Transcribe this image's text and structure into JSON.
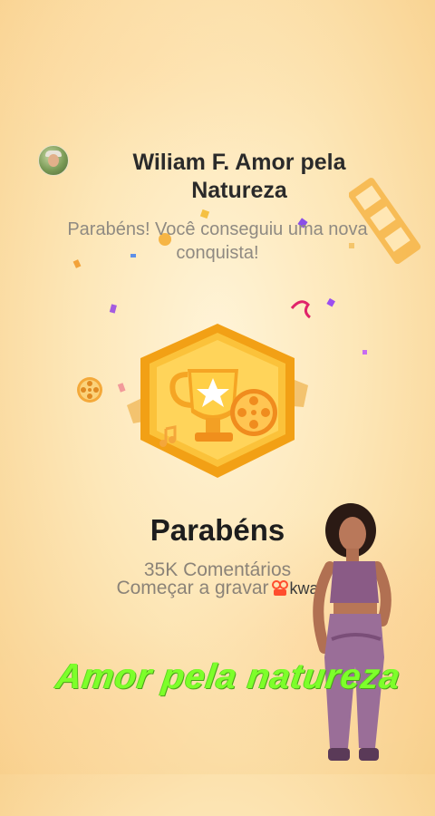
{
  "profile": {
    "name": "Wiliam F. Amor pela Natureza",
    "avatar_icon": "profile-avatar"
  },
  "message": {
    "subtitle": "Parabéns! Você conseguiu uma nova conquista!"
  },
  "achievement": {
    "badge_icon": "trophy-film-badge",
    "title": "Parabéns",
    "comments": "35K Comentários",
    "cta_text": "Começar a gravar",
    "brand_text": "kwa"
  },
  "overlay": {
    "caption": "Amor pela natureza"
  },
  "colors": {
    "accent": "#f7b21f",
    "overlay_text": "#7dff2a",
    "heading": "#1d1d1d",
    "muted": "#8b8378",
    "kwai_brand": "#ff4d2d"
  }
}
